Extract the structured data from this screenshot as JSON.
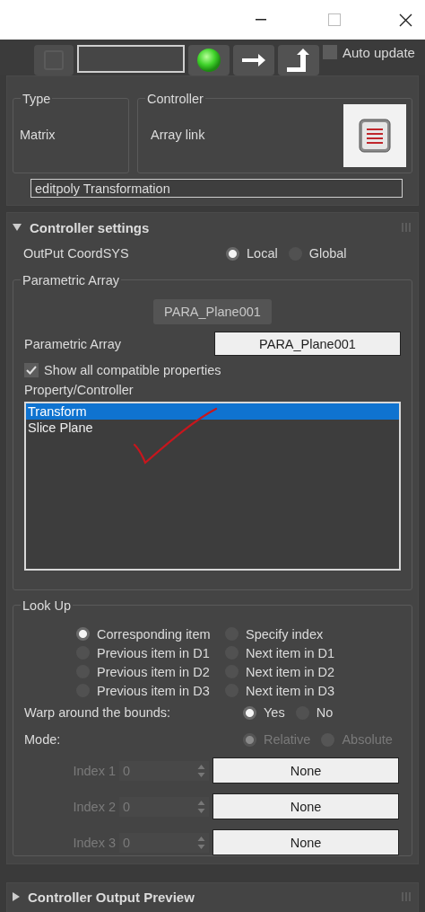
{
  "toolbar": {
    "auto_update": {
      "label": "Auto update",
      "checked": false
    }
  },
  "control_panel": {
    "type": {
      "label": "Type",
      "value": "Matrix"
    },
    "controller": {
      "label": "Controller",
      "value": "Array link"
    },
    "name_field": {
      "value": "editpoly Transformation"
    }
  },
  "controller_settings": {
    "title": "Controller settings",
    "expanded": true,
    "output_coordsys": {
      "label": "OutPut CoordSYS",
      "options": [
        {
          "label": "Local",
          "selected": true
        },
        {
          "label": "Global",
          "selected": false
        }
      ]
    },
    "parametric_array": {
      "title": "Parametric Array",
      "button": "PARA_Plane001",
      "label": "Parametric Array",
      "picker": "PARA_Plane001",
      "show_all": {
        "label": "Show all compatible properties",
        "checked": true
      },
      "list_label": "Property/Controller",
      "items": [
        {
          "label": "Transform",
          "selected": true
        },
        {
          "label": "Slice Plane",
          "selected": false
        }
      ]
    }
  },
  "look_up": {
    "title": "Look Up",
    "options": [
      {
        "label": "Corresponding item",
        "selected": true
      },
      {
        "label": "Specify index",
        "selected": false
      },
      {
        "label": "Previous item in D1",
        "selected": false
      },
      {
        "label": "Next item in D1",
        "selected": false
      },
      {
        "label": "Previous item in D2",
        "selected": false
      },
      {
        "label": "Next item in D2",
        "selected": false
      },
      {
        "label": "Previous item in D3",
        "selected": false
      },
      {
        "label": "Next item in D3",
        "selected": false
      }
    ],
    "warp": {
      "label": "Warp around the bounds:",
      "options": [
        {
          "label": "Yes",
          "selected": true
        },
        {
          "label": "No",
          "selected": false
        }
      ]
    },
    "mode": {
      "label": "Mode:",
      "disabled": true,
      "options": [
        {
          "label": "Relative",
          "selected": true
        },
        {
          "label": "Absolute",
          "selected": false
        }
      ]
    },
    "indices": [
      {
        "label": "Index 1",
        "value": "0",
        "button": "None",
        "disabled": true
      },
      {
        "label": "Index 2",
        "value": "0",
        "button": "None",
        "disabled": true
      },
      {
        "label": "Index 3",
        "value": "0",
        "button": "None",
        "disabled": true
      }
    ]
  },
  "output_preview": {
    "title": "Controller Output Preview",
    "expanded": false
  }
}
